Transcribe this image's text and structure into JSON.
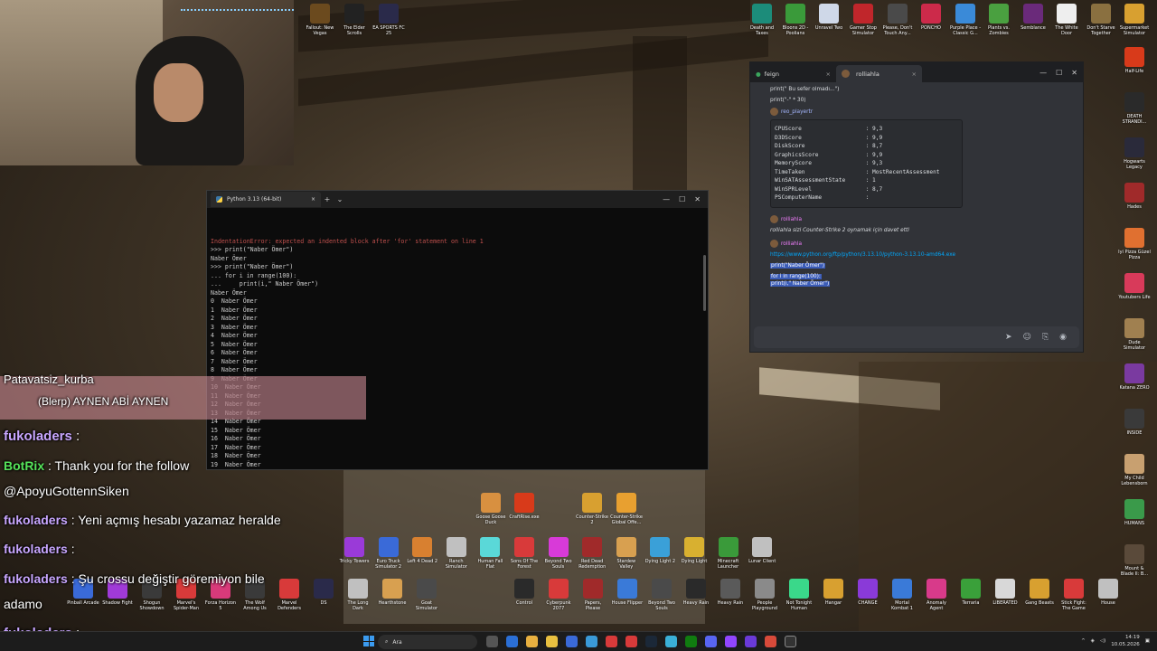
{
  "python_window": {
    "tab_title": "Python 3.13 (64-bit)",
    "tab_close": "×",
    "new_tab": "+",
    "dropdown": "⌄",
    "minimize": "—",
    "maximize": "☐",
    "close": "✕",
    "lines": [
      {
        "text": "IndentationError: expected an indented block after 'for' statement on line 1",
        "cls": "err"
      },
      {
        "text": ">>> print(\"Naber Ömer\")",
        "cls": ""
      },
      {
        "text": "Naber Ömer",
        "cls": ""
      },
      {
        "text": ">>> print(\"Naber Ömer\")",
        "cls": ""
      },
      {
        "text": "",
        "cls": ""
      },
      {
        "text": "... for i in range(100):",
        "cls": ""
      },
      {
        "text": "",
        "cls": ""
      },
      {
        "text": "...     print(i,\" Naber Ömer\")",
        "cls": ""
      },
      {
        "text": "",
        "cls": ""
      },
      {
        "text": "Naber Ömer",
        "cls": ""
      },
      {
        "text": "0  Naber Ömer",
        "cls": ""
      },
      {
        "text": "1  Naber Ömer",
        "cls": ""
      },
      {
        "text": "2  Naber Ömer",
        "cls": ""
      },
      {
        "text": "3  Naber Ömer",
        "cls": ""
      },
      {
        "text": "4  Naber Ömer",
        "cls": ""
      },
      {
        "text": "5  Naber Ömer",
        "cls": ""
      },
      {
        "text": "6  Naber Ömer",
        "cls": ""
      },
      {
        "text": "7  Naber Ömer",
        "cls": ""
      },
      {
        "text": "8  Naber Ömer",
        "cls": ""
      },
      {
        "text": "9  Naber Ömer",
        "cls": "dim"
      },
      {
        "text": "10  Naber Ömer",
        "cls": "dim"
      },
      {
        "text": "11  Naber Ömer",
        "cls": "dim"
      },
      {
        "text": "12  Naber Ömer",
        "cls": "dim"
      },
      {
        "text": "13  Naber Ömer",
        "cls": "dim"
      },
      {
        "text": "14  Naber Ömer",
        "cls": ""
      },
      {
        "text": "15  Naber Ömer",
        "cls": ""
      },
      {
        "text": "16  Naber Ömer",
        "cls": ""
      },
      {
        "text": "17  Naber Ömer",
        "cls": ""
      },
      {
        "text": "18  Naber Ömer",
        "cls": ""
      },
      {
        "text": "19  Naber Ömer",
        "cls": ""
      }
    ]
  },
  "chat_window": {
    "tabs": [
      {
        "label": "feign",
        "close": "×"
      },
      {
        "label": "rolliahla",
        "close": "×"
      }
    ],
    "win_min": "—",
    "win_max": "☐",
    "win_close": "✕",
    "line1": "print(\"  Bu sefer olmadı...\")",
    "line2": "print(\"-\" * 30)",
    "user1": "reo_playertr",
    "codeblock": "CPUScore                   : 9,3\nD3DScore                   : 9,9\nDiskScore                  : 8,7\nGraphicsScore              : 9,9\nMemoryScore                : 9,3\nTimeTaken                  : MostRecentAssessment\nWinSATAssessmentState      : 1\nWinSPRLevel                : 8,7\nPSComputerName             :",
    "user2": "rolliahla",
    "invite": "rolliahla sizi  Counter-Strike 2 oynamak için davet etti",
    "user3": "rolliahla",
    "link": "https://www.python.org/ftp/python/3.13.10/python-3.13.10-amd64.exe",
    "hl1": "print(\"Naber Ömer\")",
    "hl2": "for i in range(100):",
    "hl3": "print(i,\" Naber Ömer\")",
    "send_icon": "➤",
    "emoji_icon": "☺",
    "attach_icon": "⎘",
    "gift_icon": "◉"
  },
  "stream_chat": {
    "banner_user": "Patavatsiz_kurba",
    "banner_msg": "(Blerp) AYNEN ABİ AYNEN",
    "msgs": [
      {
        "user": "fukoladers",
        "sep": " :",
        "text": ""
      },
      {
        "user": "BotRix",
        "sep": " :",
        "text": " Thank you for the follow"
      },
      {
        "user": "",
        "sep": "",
        "text": "@ApoyuGottennSiken"
      },
      {
        "user": "fukoladers",
        "sep": " :",
        "text": " Yeni açmış hesabı yazamaz heralde"
      },
      {
        "user": "fukoladers",
        "sep": " :",
        "text": ""
      },
      {
        "user": "fukoladers",
        "sep": " :",
        "text": " Şu crossu değiştir göremiyon bile"
      },
      {
        "user": "",
        "sep": "",
        "text": "adamo"
      },
      {
        "user": "fukoladers",
        "sep": " :",
        "text": ""
      }
    ]
  },
  "desktop_icons_top": [
    {
      "label": "Fallout: New Vegas",
      "color": "#6b4a1e"
    },
    {
      "label": "The Elder Scrolls",
      "color": "#222"
    },
    {
      "label": "EA SPORTS FC 25",
      "color": "#2a2a4a"
    },
    {
      "label": "Death and Taxes",
      "color": "#1c8c7a"
    },
    {
      "label": "Bloons 2D - Poolians",
      "color": "#3a9a3a"
    },
    {
      "label": "Unravel Two",
      "color": "#cfd8e8"
    },
    {
      "label": "Gamer Stop Simulator",
      "color": "#c0262b"
    },
    {
      "label": "Please, Don't Touch Any...",
      "color": "#4a4a4a"
    },
    {
      "label": "PONCHO",
      "color": "#cc2a4a"
    },
    {
      "label": "Purple Place - Classic G...",
      "color": "#3a8ad8"
    },
    {
      "label": "Plants vs. Zombies",
      "color": "#4aa040"
    },
    {
      "label": "Semblance",
      "color": "#6a2a7a"
    },
    {
      "label": "The White Door",
      "color": "#eeeeee"
    },
    {
      "label": "Don't Starve Together",
      "color": "#8a7040"
    },
    {
      "label": "Supermarket Simulator",
      "color": "#d8a030"
    }
  ],
  "desktop_icons_right": [
    {
      "label": "Half-Life",
      "color": "#d83a1a"
    },
    {
      "label": "DEATH STRANDI...",
      "color": "#2a2a2a"
    },
    {
      "label": "Hogwarts Legacy",
      "color": "#2a2a3a"
    },
    {
      "label": "Hades",
      "color": "#a02a2a"
    },
    {
      "label": "İyi Pizza Güzel Pizza",
      "color": "#e07030"
    },
    {
      "label": "Youtubers Life",
      "color": "#d83a5a"
    },
    {
      "label": "Dude Simulator",
      "color": "#a08050"
    },
    {
      "label": "Katana ZERO",
      "color": "#7a3aa0"
    },
    {
      "label": "INSIDE",
      "color": "#3a3a3a"
    },
    {
      "label": "My Child Lebensborn",
      "color": "#c8a070"
    },
    {
      "label": "HUMANS",
      "color": "#3a9a4a"
    },
    {
      "label": "Mount & Blade II: B...",
      "color": "#5a4a3a"
    }
  ],
  "desktop_icons_mid": [
    {
      "label": "Goose Goose Duck",
      "color": "#d89040"
    },
    {
      "label": "CraftRise.exe",
      "color": "#d83a1a"
    },
    {
      "label": "Counter-Strike 2",
      "color": "#d8a030"
    },
    {
      "label": "Counter-Strike Global Offe...",
      "color": "#e8a030"
    }
  ],
  "desktop_icons_row1": [
    {
      "label": "Tricky Towers",
      "color": "#9a3ad8"
    },
    {
      "label": "Euro Truck Simulator 2",
      "color": "#3a6ad8"
    },
    {
      "label": "Left 4 Dead 2",
      "color": "#d88030"
    },
    {
      "label": "Ranch Simulator",
      "color": "#c0c0c0"
    },
    {
      "label": "Human Fall Flat",
      "color": "#5ad8d8"
    },
    {
      "label": "Sons Of The Forest",
      "color": "#d83a3a"
    },
    {
      "label": "Beyond Two Souls",
      "color": "#d83ad8"
    },
    {
      "label": "Red Dead Redemption",
      "color": "#a02a2a"
    },
    {
      "label": "Stardew Valley",
      "color": "#d8a050"
    },
    {
      "label": "Dying Light 2",
      "color": "#3aa0d8"
    },
    {
      "label": "Dying Light",
      "color": "#d8b030"
    },
    {
      "label": "Minecraft Launcher",
      "color": "#3a9a3a"
    },
    {
      "label": "Lunar Client",
      "color": "#c0c0c0"
    }
  ],
  "desktop_icons_row2": [
    {
      "label": "Pinball Arcade",
      "color": "#3a6ad8"
    },
    {
      "label": "Shadow Fight",
      "color": "#a03ad8"
    },
    {
      "label": "Shogun Showdown",
      "color": "#3a3a3a"
    },
    {
      "label": "Marvel's Spider-Man",
      "color": "#d83a3a"
    },
    {
      "label": "Forza Horizon 5",
      "color": "#d83a7a"
    },
    {
      "label": "The Wolf Among Us",
      "color": "#3a3a3a"
    },
    {
      "label": "Marvel Defenders",
      "color": "#d83a3a"
    },
    {
      "label": "DS",
      "color": "#2a2a4a"
    },
    {
      "label": "The Long Dark",
      "color": "#c0c0c0"
    },
    {
      "label": "Hearthstone",
      "color": "#d8a050"
    },
    {
      "label": "Goat Simulator",
      "color": "#4a4a4a"
    },
    {
      "label": "Control",
      "color": "#2a2a2a"
    },
    {
      "label": "Cyberpunk 2077",
      "color": "#d83a3a"
    },
    {
      "label": "Papers, Please",
      "color": "#a02a2a"
    },
    {
      "label": "House Flipper",
      "color": "#3a7ad8"
    },
    {
      "label": "Beyond Two Souls",
      "color": "#4a4a4a"
    },
    {
      "label": "Heavy Rain",
      "color": "#2a2a2a"
    },
    {
      "label": "Heavy Rain",
      "color": "#5a5a5a"
    },
    {
      "label": "People Playground",
      "color": "#8a8a8a"
    },
    {
      "label": "Not Tonight Human",
      "color": "#3ad88a"
    },
    {
      "label": "Hangar",
      "color": "#d8a030"
    },
    {
      "label": "CHANGE",
      "color": "#8a3ad8"
    },
    {
      "label": "Mortal Kombat 1",
      "color": "#3a7ad8"
    },
    {
      "label": "Anomaly Agent",
      "color": "#d83a8a"
    },
    {
      "label": "Terraria",
      "color": "#3aa03a"
    },
    {
      "label": "LIBERATED",
      "color": "#d8d8d8"
    },
    {
      "label": "Gang Beasts",
      "color": "#d8a030"
    },
    {
      "label": "Stick Fight: The Game",
      "color": "#d83a3a"
    },
    {
      "label": "House",
      "color": "#c0c0c0"
    }
  ],
  "taskbar": {
    "search_label": "Ara",
    "clock_time": "14:19",
    "clock_date": "10.05.2026"
  }
}
